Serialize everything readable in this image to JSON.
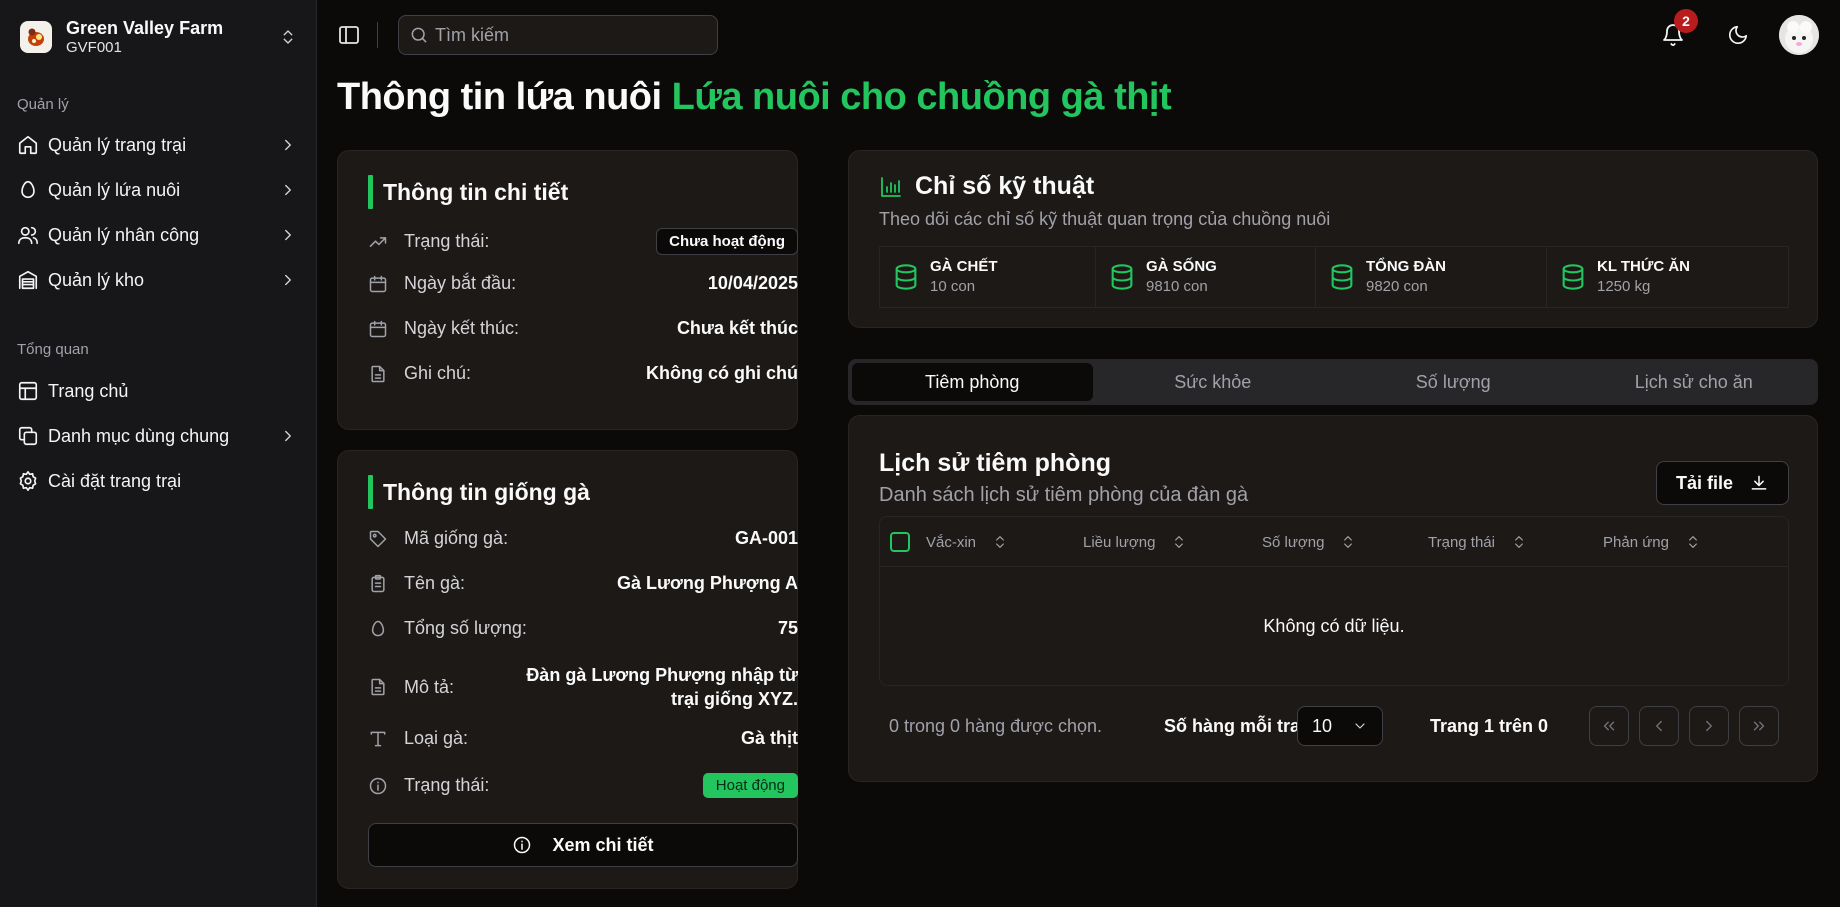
{
  "brand": {
    "name": "Green Valley Farm",
    "code": "GVF001"
  },
  "sidebar": {
    "group1_label": "Quản lý",
    "group1": [
      {
        "label": "Quản lý trang trại",
        "icon": "home-icon"
      },
      {
        "label": "Quản lý lứa nuôi",
        "icon": "egg-icon"
      },
      {
        "label": "Quản lý nhân công",
        "icon": "users-icon"
      },
      {
        "label": "Quản lý kho",
        "icon": "warehouse-icon"
      }
    ],
    "group2_label": "Tổng quan",
    "group2": [
      {
        "label": "Trang chủ",
        "icon": "layout-icon"
      },
      {
        "label": "Danh mục dùng chung",
        "icon": "copy-icon"
      },
      {
        "label": "Cài đặt trang trại",
        "icon": "gear-icon"
      }
    ]
  },
  "header": {
    "search_placeholder": "Tìm kiếm",
    "notification_count": "2"
  },
  "page": {
    "title": "Thông tin lứa nuôi",
    "title_accent": "Lứa nuôi cho chuồng gà thịt"
  },
  "detail": {
    "title": "Thông tin chi tiết",
    "status_label": "Trạng thái:",
    "status_value": "Chưa hoạt động",
    "start_label": "Ngày bắt đầu:",
    "start_value": "10/04/2025",
    "end_label": "Ngày kết thúc:",
    "end_value": "Chưa kết thúc",
    "note_label": "Ghi chú:",
    "note_value": "Không có ghi chú"
  },
  "breed": {
    "title": "Thông tin giống gà",
    "code_label": "Mã giống gà:",
    "code_value": "GA-001",
    "name_label": "Tên gà:",
    "name_value": "Gà Lương Phượng A",
    "total_label": "Tổng số lượng:",
    "total_value": "75",
    "desc_label": "Mô tả:",
    "desc_value": "Đàn gà Lương Phượng nhập từ trại giống XYZ.",
    "type_label": "Loại gà:",
    "type_value": "Gà thịt",
    "status_label": "Trạng thái:",
    "status_value": "Hoạt động",
    "detail_button": "Xem chi tiết"
  },
  "tech": {
    "title": "Chỉ số kỹ thuật",
    "subtitle": "Theo dõi các chỉ số kỹ thuật quan trọng của chuồng nuôi",
    "stats": [
      {
        "label": "GÀ CHẾT",
        "value": "10 con"
      },
      {
        "label": "GÀ SỐNG",
        "value": "9810 con"
      },
      {
        "label": "TỔNG ĐÀN",
        "value": "9820 con"
      },
      {
        "label": "KL THỨC ĂN",
        "value": "1250 kg"
      }
    ]
  },
  "tabs": [
    "Tiêm phòng",
    "Sức khỏe",
    "Số lượng",
    "Lịch sử cho ăn"
  ],
  "vaccine": {
    "title": "Lịch sử tiêm phòng",
    "subtitle": "Danh sách lịch sử tiêm phòng của đàn gà",
    "download_button": "Tải file",
    "columns": [
      "Vắc-xin",
      "Liều lượng",
      "Số lượng",
      "Trạng thái",
      "Phản ứng"
    ],
    "empty_text": "Không có dữ liệu.",
    "selected_text": "0 trong 0 hàng được chọn.",
    "rows_per_page_label": "Số hàng mỗi trang",
    "rows_per_page_value": "10",
    "page_text": "Trang 1 trên 0"
  },
  "colors": {
    "accent": "#22c55e",
    "badge": "#b91c1c",
    "background": "#0c0a09"
  }
}
